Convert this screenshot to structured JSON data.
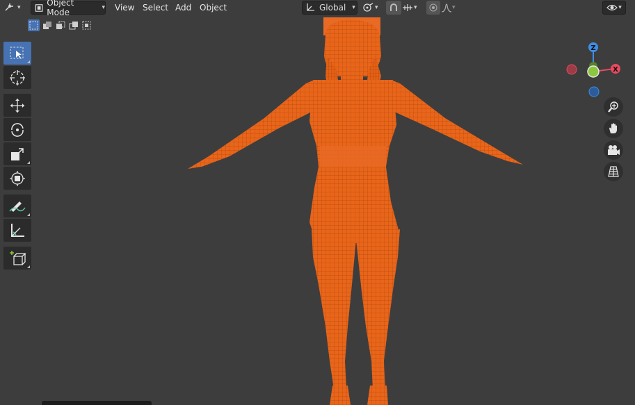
{
  "header": {
    "mode_label": "Object Mode",
    "menus": [
      "View",
      "Select",
      "Add",
      "Object"
    ],
    "orientation_label": "Global"
  },
  "colors": {
    "viewport_bg": "#3d3d3d",
    "selection_orange": "#e8651a",
    "active_blue": "#4772b3",
    "axis_x": "#e84a5f",
    "axis_y": "#8cc63f",
    "axis_z": "#3d8fe8"
  },
  "toolbar": {
    "tools": [
      "select-box-icon",
      "cursor-icon",
      "move-icon",
      "rotate-icon",
      "scale-icon",
      "transform-icon",
      "annotate-icon",
      "measure-icon",
      "add-cube-icon"
    ],
    "active_tool": "select-box-icon"
  },
  "gizmo": {
    "x_label": "X",
    "z_label": "Z"
  },
  "nav_buttons": [
    "zoom-icon",
    "hand-pan-icon",
    "camera-icon",
    "grid-perspective-icon"
  ]
}
